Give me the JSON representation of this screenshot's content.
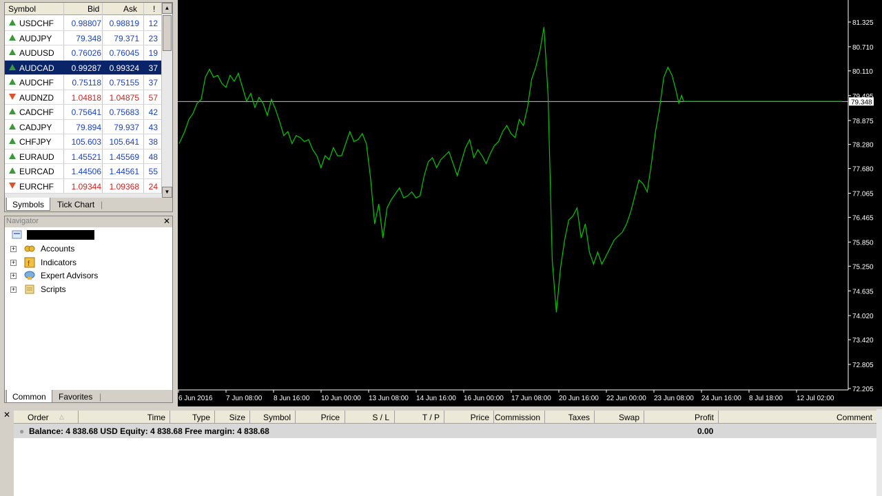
{
  "market_watch": {
    "headers": {
      "symbol": "Symbol",
      "bid": "Bid",
      "ask": "Ask",
      "spread": "!"
    },
    "rows": [
      {
        "symbol": "USDCHF",
        "bid": "0.98807",
        "ask": "0.98819",
        "spread": "12",
        "dir": "up",
        "color": "blue"
      },
      {
        "symbol": "AUDJPY",
        "bid": "79.348",
        "ask": "79.371",
        "spread": "23",
        "dir": "up",
        "color": "blue"
      },
      {
        "symbol": "AUDUSD",
        "bid": "0.76026",
        "ask": "0.76045",
        "spread": "19",
        "dir": "up",
        "color": "blue"
      },
      {
        "symbol": "AUDCAD",
        "bid": "0.99287",
        "ask": "0.99324",
        "spread": "37",
        "dir": "up",
        "color": "blue",
        "selected": true
      },
      {
        "symbol": "AUDCHF",
        "bid": "0.75118",
        "ask": "0.75155",
        "spread": "37",
        "dir": "up",
        "color": "blue"
      },
      {
        "symbol": "AUDNZD",
        "bid": "1.04818",
        "ask": "1.04875",
        "spread": "57",
        "dir": "down",
        "color": "red"
      },
      {
        "symbol": "CADCHF",
        "bid": "0.75641",
        "ask": "0.75683",
        "spread": "42",
        "dir": "up",
        "color": "blue"
      },
      {
        "symbol": "CADJPY",
        "bid": "79.894",
        "ask": "79.937",
        "spread": "43",
        "dir": "up",
        "color": "blue"
      },
      {
        "symbol": "CHFJPY",
        "bid": "105.603",
        "ask": "105.641",
        "spread": "38",
        "dir": "up",
        "color": "blue"
      },
      {
        "symbol": "EURAUD",
        "bid": "1.45521",
        "ask": "1.45569",
        "spread": "48",
        "dir": "up",
        "color": "blue"
      },
      {
        "symbol": "EURCAD",
        "bid": "1.44506",
        "ask": "1.44561",
        "spread": "55",
        "dir": "up",
        "color": "blue"
      },
      {
        "symbol": "EURCHF",
        "bid": "1.09344",
        "ask": "1.09368",
        "spread": "24",
        "dir": "down",
        "color": "red"
      }
    ],
    "tabs": [
      "Symbols",
      "Tick Chart"
    ]
  },
  "navigator": {
    "title": "Navigator",
    "items": [
      {
        "label": "Accounts",
        "icon": "accounts-icon"
      },
      {
        "label": "Indicators",
        "icon": "indicators-icon"
      },
      {
        "label": "Expert Advisors",
        "icon": "expert-advisors-icon"
      },
      {
        "label": "Scripts",
        "icon": "scripts-icon"
      }
    ],
    "tabs": [
      "Common",
      "Favorites"
    ]
  },
  "chart": {
    "current_price": "79.348",
    "colors": {
      "background": "#000000",
      "line": "#00c800",
      "axis_text": "#ffffff",
      "price_line": "#c0c0c0"
    }
  },
  "chart_data": {
    "type": "line",
    "symbol": "AUDJPY",
    "y_ticks": [
      "81.325",
      "80.710",
      "80.110",
      "79.495",
      "78.875",
      "78.280",
      "77.680",
      "77.065",
      "76.465",
      "75.850",
      "75.250",
      "74.635",
      "74.020",
      "73.420",
      "72.805",
      "72.205"
    ],
    "x_ticks": [
      "6 Jun 2016",
      "7 Jun 08:00",
      "8 Jun 16:00",
      "10 Jun 00:00",
      "13 Jun 08:00",
      "14 Jun 16:00",
      "16 Jun 00:00",
      "17 Jun 08:00",
      "20 Jun 16:00",
      "22 Jun 00:00",
      "23 Jun 08:00",
      "24 Jun 16:00",
      "8 Jul 18:00",
      "12 Jul 02:00"
    ],
    "ylim": [
      72.205,
      81.325
    ],
    "x": [
      0,
      4,
      8,
      14,
      20,
      26,
      32,
      38,
      44,
      50,
      56,
      62,
      68,
      74,
      80,
      86,
      92,
      98,
      104,
      110,
      116,
      122,
      128,
      134,
      140,
      146,
      152,
      158,
      164,
      170,
      176,
      182,
      188,
      194,
      200,
      206,
      212,
      218,
      224,
      230,
      236,
      242,
      248,
      254,
      260,
      266,
      272,
      278,
      284,
      290,
      296,
      302,
      308,
      314,
      320,
      326,
      332,
      338,
      344,
      350,
      356,
      362,
      368,
      374,
      380,
      386,
      392,
      398,
      404,
      410,
      416,
      422,
      428,
      434,
      440,
      446,
      452,
      458,
      464,
      470,
      476,
      482,
      488,
      494,
      500,
      506,
      512,
      518,
      524,
      530,
      536,
      542,
      548,
      554,
      560,
      566,
      572,
      578,
      584,
      590,
      596,
      602,
      608,
      614,
      620,
      626,
      632,
      638,
      644,
      650,
      656,
      662,
      668,
      674,
      680,
      686,
      692,
      698,
      704,
      710,
      716,
      722,
      726,
      730,
      733,
      736,
      739,
      742,
      745,
      750,
      756,
      762,
      768,
      774,
      780,
      786,
      792,
      798,
      804,
      810,
      816,
      822,
      828,
      834,
      840,
      846,
      852,
      858,
      864,
      870,
      876,
      882,
      888,
      894,
      900,
      906,
      912,
      918,
      924,
      930,
      936,
      942,
      948,
      954,
      960,
      963
    ],
    "values": [
      78.3,
      78.45,
      78.6,
      78.9,
      79.05,
      79.3,
      79.4,
      79.95,
      80.15,
      79.95,
      80.0,
      79.8,
      79.7,
      80.0,
      79.85,
      80.05,
      79.7,
      79.35,
      79.55,
      79.2,
      79.45,
      79.3,
      79.0,
      79.4,
      79.15,
      78.85,
      78.5,
      78.6,
      78.3,
      78.5,
      78.45,
      78.35,
      78.4,
      78.15,
      78.0,
      77.7,
      78.0,
      77.9,
      78.2,
      78.0,
      78.0,
      78.3,
      78.6,
      78.35,
      78.4,
      78.55,
      78.3,
      77.45,
      76.3,
      76.8,
      75.95,
      76.7,
      76.9,
      77.05,
      77.2,
      76.95,
      77.0,
      77.1,
      76.95,
      77.0,
      77.5,
      77.85,
      77.95,
      77.7,
      77.9,
      78.0,
      78.1,
      77.8,
      77.5,
      77.85,
      78.2,
      78.4,
      77.95,
      78.15,
      78.0,
      77.8,
      78.05,
      78.25,
      78.35,
      78.6,
      78.75,
      78.55,
      78.45,
      78.9,
      78.75,
      79.2,
      79.9,
      80.2,
      80.6,
      81.2,
      79.5,
      75.4,
      74.1,
      75.2,
      75.9,
      76.4,
      76.5,
      76.7,
      75.95,
      76.3,
      75.6,
      75.3,
      75.6,
      75.3,
      75.5,
      75.7,
      75.9,
      76.0,
      76.1,
      76.3,
      76.6,
      77.0,
      77.4,
      77.3,
      77.1,
      77.8,
      78.6,
      79.2,
      79.95,
      80.2,
      80.0,
      79.6,
      79.3,
      79.5,
      79.35,
      79.35,
      79.35,
      79.35,
      79.35,
      79.35,
      79.35,
      79.35,
      79.35,
      79.35,
      79.35,
      79.35,
      79.35,
      79.35,
      79.35,
      79.35,
      79.35,
      79.35,
      79.35,
      79.35,
      79.35,
      79.35,
      79.35,
      79.35,
      79.35,
      79.35,
      79.35,
      79.35,
      79.35,
      79.35,
      79.35,
      79.35,
      79.35,
      79.35,
      79.35,
      79.35,
      79.35,
      79.35,
      79.35,
      79.35,
      79.35,
      79.35
    ]
  },
  "terminal": {
    "columns": [
      "Order",
      "Time",
      "Type",
      "Size",
      "Symbol",
      "Price",
      "S / L",
      "T / P",
      "Price",
      "Commission",
      "Taxes",
      "Swap",
      "Profit",
      "Comment"
    ],
    "balance_text": "Balance: 4 838.68 USD  Equity: 4 838.68  Free margin: 4 838.68",
    "profit": "0.00"
  }
}
